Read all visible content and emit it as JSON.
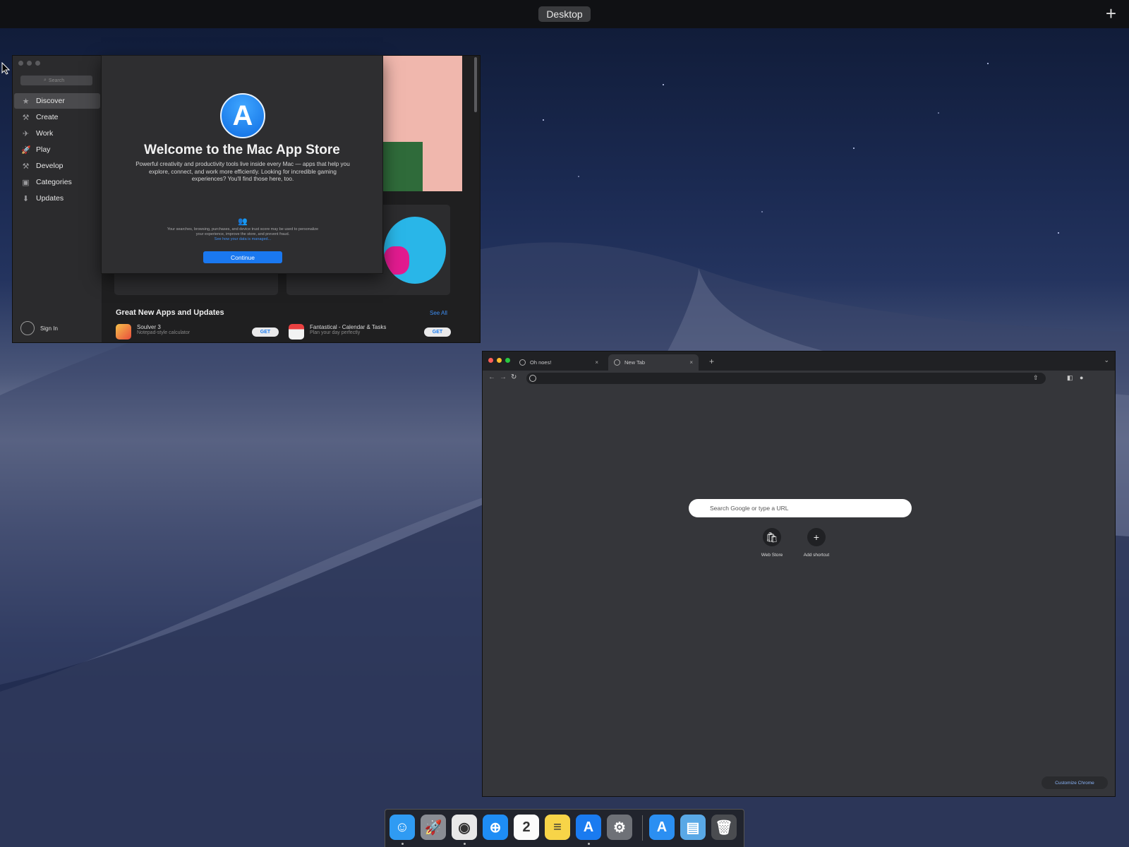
{
  "mission_control": {
    "space_label": "Desktop",
    "add_label": "+"
  },
  "app_store": {
    "search_placeholder": "Search",
    "sidebar": [
      {
        "label": "Discover",
        "icon": "star-icon",
        "glyph": "★"
      },
      {
        "label": "Create",
        "icon": "hammer-icon",
        "glyph": "⚒"
      },
      {
        "label": "Work",
        "icon": "paper-plane-icon",
        "glyph": "✈"
      },
      {
        "label": "Play",
        "icon": "rocket-icon",
        "glyph": "🚀"
      },
      {
        "label": "Develop",
        "icon": "hammer-icon",
        "glyph": "⚒"
      },
      {
        "label": "Categories",
        "icon": "categories-icon",
        "glyph": "▣"
      },
      {
        "label": "Updates",
        "icon": "updates-icon",
        "glyph": "⬇"
      }
    ],
    "sign_in_label": "Sign In",
    "section_title": "Great New Apps and Updates",
    "see_all_label": "See All",
    "apps": [
      {
        "name": "Soulver 3",
        "subtitle": "Notepad-style calculator",
        "get_label": "GET"
      },
      {
        "name": "Fantastical - Calendar & Tasks",
        "subtitle": "Plan your day perfectly",
        "get_label": "GET"
      }
    ],
    "welcome": {
      "title": "Welcome to the Mac App Store",
      "body": "Powerful creativity and productivity tools live inside every Mac — apps that help you explore, connect, and work more efficiently. Looking for incredible gaming experiences? You'll find those here, too.",
      "privacy_text": "Your searches, browsing, purchases, and device trust score may be used to personalize your experience, improve the store, and prevent fraud.",
      "privacy_link": "See how your data is managed...",
      "continue_label": "Continue"
    }
  },
  "chrome": {
    "tabs": [
      {
        "title": "Oh noes!",
        "close": "×"
      },
      {
        "title": "New Tab",
        "close": "×"
      }
    ],
    "new_tab_label": "+",
    "search_placeholder": "Search Google or type a URL",
    "shortcuts": [
      {
        "label": "Web Store",
        "glyph": "🛍"
      },
      {
        "label": "Add shortcut",
        "glyph": "+"
      }
    ],
    "customize_label": "Customize Chrome"
  },
  "dock": [
    {
      "name": "finder-icon",
      "glyph": "☺",
      "color": "#2f9bf3",
      "running": true
    },
    {
      "name": "launchpad-icon",
      "glyph": "🚀",
      "color": "#8a8d94",
      "running": false
    },
    {
      "name": "chrome-icon",
      "glyph": "◉",
      "color": "#e8e8e8",
      "running": true
    },
    {
      "name": "safari-icon",
      "glyph": "⊕",
      "color": "#1e8df5",
      "running": false
    },
    {
      "name": "calendar-icon",
      "glyph": "2",
      "color": "#fbfbfb",
      "running": false
    },
    {
      "name": "notes-icon",
      "glyph": "≡",
      "color": "#f7d448",
      "running": false
    },
    {
      "name": "app-store-icon",
      "glyph": "A",
      "color": "#1a7bf0",
      "running": true
    },
    {
      "name": "system-preferences-icon",
      "glyph": "⚙",
      "color": "#6e7177",
      "running": false
    },
    {
      "name": "app-store-folder-icon",
      "glyph": "A",
      "color": "#2b8ff2",
      "running": false
    },
    {
      "name": "downloads-folder-icon",
      "glyph": "▤",
      "color": "#59a8e6",
      "running": false
    },
    {
      "name": "trash-icon",
      "glyph": "🗑",
      "color": "#4a4c50",
      "running": false
    }
  ]
}
